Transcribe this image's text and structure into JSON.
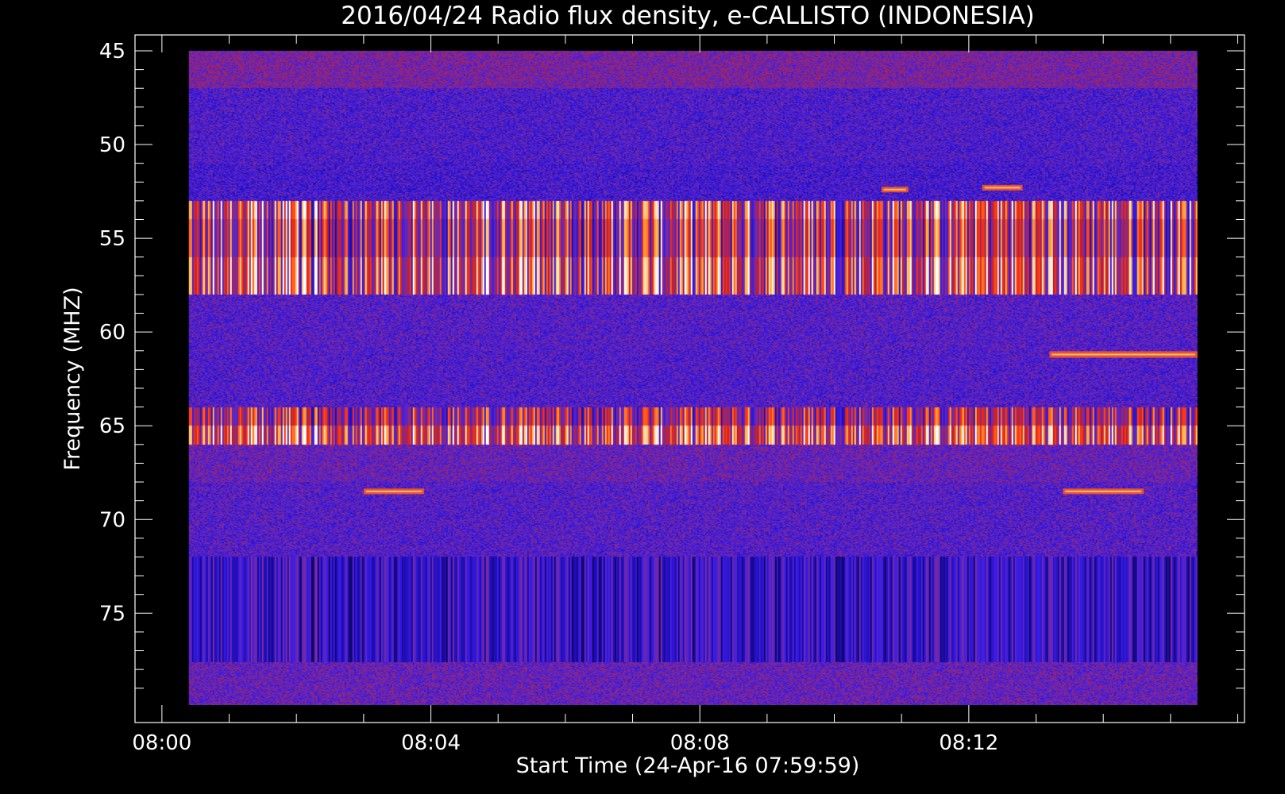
{
  "chart_data": {
    "type": "heatmap",
    "title": "2016/04/24  Radio flux density, e-CALLISTO (INDONESIA)",
    "xlabel": "Start Time (24-Apr-16 07:59:59)",
    "ylabel": "Frequency (MHZ)",
    "x_tick_labels": [
      "08:00",
      "08:04",
      "08:08",
      "08:12"
    ],
    "x_tick_minutes": [
      0,
      4,
      8,
      12
    ],
    "x_minor_step_minutes": 1,
    "xlim_minutes": [
      -0.4,
      16.1
    ],
    "data_x_range_minutes": [
      0.4,
      15.4
    ],
    "y_tick_labels": [
      "45",
      "50",
      "55",
      "60",
      "65",
      "70",
      "75"
    ],
    "y_tick_values": [
      45,
      50,
      55,
      60,
      65,
      70,
      75
    ],
    "y_minor_step": 1,
    "ylim": [
      45,
      79.9
    ],
    "y_inverted": true,
    "data_y_range": [
      45.9,
      79.9
    ],
    "colormap": [
      "#000000",
      "#1a0aa8",
      "#3a1ce8",
      "#7a2aa0",
      "#c02030",
      "#ff3a10",
      "#ffb040",
      "#ffffff"
    ],
    "bands": [
      {
        "from": 45.0,
        "to": 47.0,
        "level": 0.42,
        "stripe": 0.0
      },
      {
        "from": 47.0,
        "to": 51.0,
        "level": 0.32,
        "stripe": 0.0
      },
      {
        "from": 51.0,
        "to": 53.0,
        "level": 0.3,
        "stripe": 0.0
      },
      {
        "from": 53.0,
        "to": 54.0,
        "level": 0.62,
        "stripe": 0.85
      },
      {
        "from": 54.0,
        "to": 56.0,
        "level": 0.55,
        "stripe": 0.8
      },
      {
        "from": 56.0,
        "to": 58.0,
        "level": 0.65,
        "stripe": 0.85
      },
      {
        "from": 58.0,
        "to": 61.0,
        "level": 0.34,
        "stripe": 0.0
      },
      {
        "from": 61.0,
        "to": 64.0,
        "level": 0.33,
        "stripe": 0.0
      },
      {
        "from": 64.0,
        "to": 65.0,
        "level": 0.52,
        "stripe": 0.7
      },
      {
        "from": 65.0,
        "to": 66.0,
        "level": 0.68,
        "stripe": 0.75
      },
      {
        "from": 66.0,
        "to": 68.0,
        "level": 0.38,
        "stripe": 0.0
      },
      {
        "from": 68.0,
        "to": 72.0,
        "level": 0.34,
        "stripe": 0.0
      },
      {
        "from": 72.0,
        "to": 77.6,
        "level": 0.26,
        "stripe": 0.35
      },
      {
        "from": 77.6,
        "to": 79.9,
        "level": 0.38,
        "stripe": 0.0
      }
    ],
    "bursts": [
      {
        "t0": 3.0,
        "t1": 3.9,
        "f": 68.5,
        "width": 0.3
      },
      {
        "t0": 13.4,
        "t1": 14.6,
        "f": 68.5,
        "width": 0.3
      },
      {
        "t0": 13.2,
        "t1": 15.4,
        "f": 61.2,
        "width": 0.35
      },
      {
        "t0": 10.7,
        "t1": 11.1,
        "f": 52.4,
        "width": 0.3
      },
      {
        "t0": 12.2,
        "t1": 12.8,
        "f": 52.3,
        "width": 0.3
      }
    ]
  }
}
